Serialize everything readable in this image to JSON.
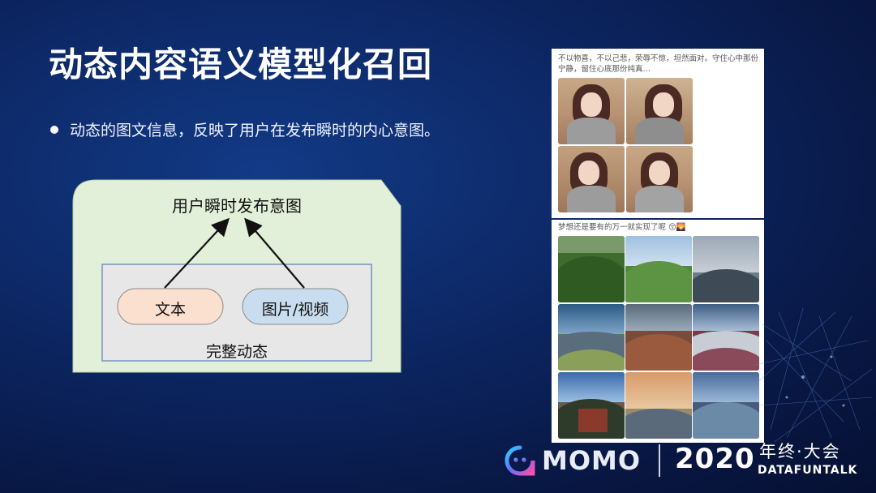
{
  "slide": {
    "title": "动态内容语义模型化召回",
    "bullet": "动态的图文信息，反映了用户在发布瞬时的内心意图。"
  },
  "diagram": {
    "intent_label": "用户瞬时发布意图",
    "text_node": "文本",
    "media_node": "图片/视频",
    "container_label": "完整动态",
    "colors": {
      "outer_fill": "#e2f0d9",
      "inner_fill": "#e7e7e7",
      "inner_border": "#5b7db8",
      "text_pill": "#fbe0d0",
      "media_pill": "#c9ddf0"
    }
  },
  "posts": [
    {
      "caption": "不以物喜，不以己悲，荣辱不惊，坦然面对。守住心中那份宁静，留住心底那份纯真…",
      "image_count": 4
    },
    {
      "caption": "梦想还是要有的万一就实现了呢 😚🌄",
      "image_count": 9
    }
  ],
  "footer": {
    "logo_text": "MOMO",
    "year": "2020",
    "event": "年终·大会",
    "brand": "DATAFUNTALK"
  }
}
